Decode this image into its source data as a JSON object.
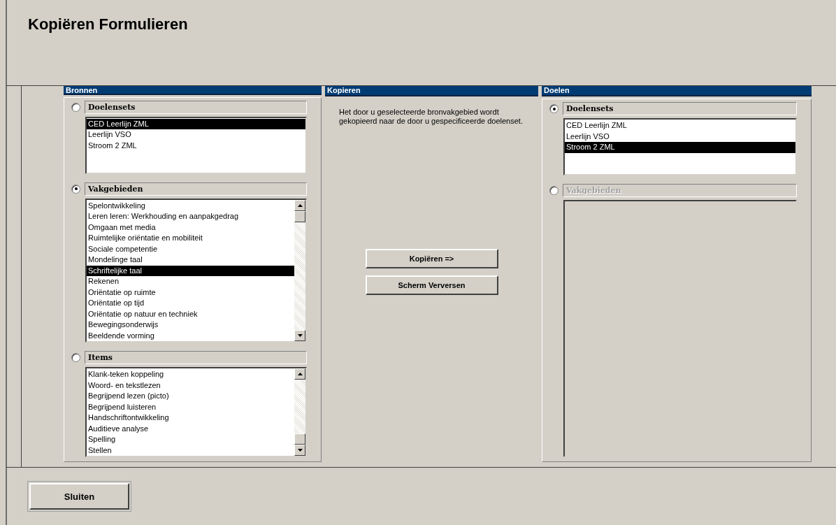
{
  "window": {
    "title": "Kopiëren Formulieren"
  },
  "panels": [
    {
      "kind": "source",
      "header": "Bronnen",
      "groups": [
        {
          "label": "Doelensets",
          "selected": false,
          "disabled": false,
          "items": [
            {
              "text": "CED Leerlijn ZML",
              "selected": true
            },
            {
              "text": "Leerlijn VSO",
              "selected": false
            },
            {
              "text": "Stroom 2 ZML",
              "selected": false
            }
          ]
        },
        {
          "label": "Vakgebieden",
          "selected": true,
          "disabled": false,
          "items": [
            {
              "text": "Spelontwikkeling",
              "selected": false
            },
            {
              "text": "Leren leren: Werkhouding en aanpakgedrag",
              "selected": false
            },
            {
              "text": "Omgaan met media",
              "selected": false
            },
            {
              "text": "Ruimtelijke oriëntatie en mobiliteit",
              "selected": false
            },
            {
              "text": "Sociale competentie",
              "selected": false
            },
            {
              "text": "Mondelinge taal",
              "selected": false
            },
            {
              "text": "Schriftelijke taal",
              "selected": true
            },
            {
              "text": "Rekenen",
              "selected": false
            },
            {
              "text": "Oriëntatie op ruimte",
              "selected": false
            },
            {
              "text": "Oriëntatie op tijd",
              "selected": false
            },
            {
              "text": "Oriëntatie op natuur en techniek",
              "selected": false
            },
            {
              "text": "Bewegingsonderwijs",
              "selected": false
            },
            {
              "text": "Beeldende vorming",
              "selected": false
            }
          ]
        },
        {
          "label": "Items",
          "selected": false,
          "disabled": false,
          "items": [
            {
              "text": "Klank-teken koppeling",
              "selected": false
            },
            {
              "text": "Woord- en tekstlezen",
              "selected": false
            },
            {
              "text": "Begrijpend lezen (picto)",
              "selected": false
            },
            {
              "text": "Begrijpend luisteren",
              "selected": false
            },
            {
              "text": "Handschriftontwikkeling",
              "selected": false
            },
            {
              "text": "Auditieve analyse",
              "selected": false
            },
            {
              "text": "Spelling",
              "selected": false
            },
            {
              "text": "Stellen",
              "selected": false
            }
          ]
        }
      ]
    },
    {
      "kind": "copy",
      "header": "Kopieren",
      "description": "Het door u geselecteerde bronvakgebied wordt gekopieerd naar de door u gespecificeerde doelenset.",
      "buttons": [
        "Kopiëren =>",
        "Scherm Verversen"
      ]
    },
    {
      "kind": "target",
      "header": "Doelen",
      "groups": [
        {
          "label": "Doelensets",
          "selected": true,
          "disabled": false,
          "items": [
            {
              "text": "CED Leerlijn ZML",
              "selected": false
            },
            {
              "text": "Leerlijn VSO",
              "selected": false
            },
            {
              "text": "Stroom 2 ZML",
              "selected": true
            }
          ]
        },
        {
          "label": "Vakgebieden",
          "selected": false,
          "disabled": true
        }
      ]
    }
  ],
  "footer_buttons": [
    "Sluiten"
  ]
}
